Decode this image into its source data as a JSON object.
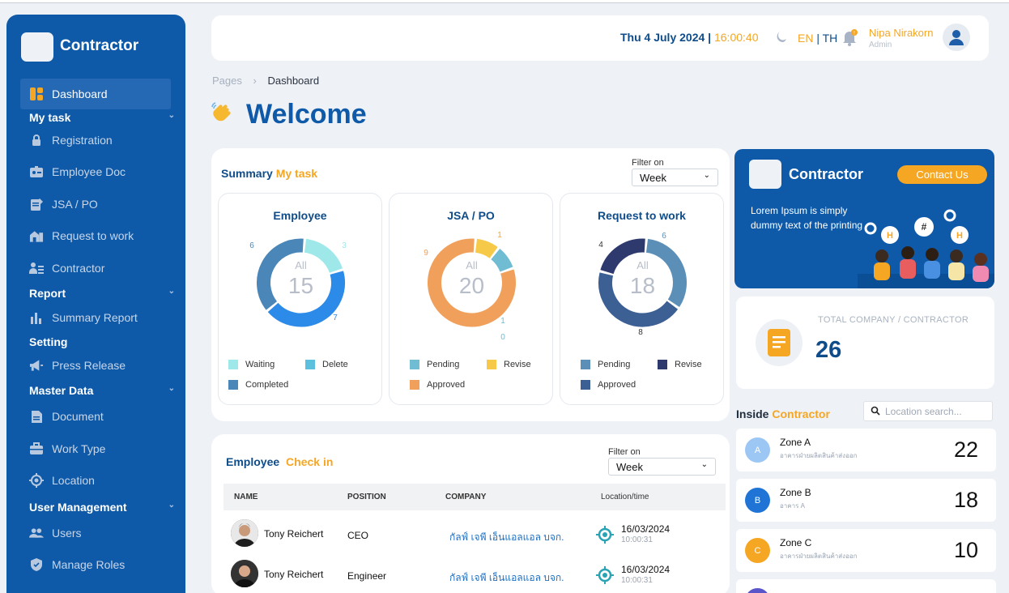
{
  "sidebar": {
    "brand": "Contractor",
    "dashboard": "Dashboard",
    "sections": {
      "my_task": "My task",
      "report": "Report",
      "setting": "Setting",
      "master_data": "Master Data",
      "user_management": "User Management"
    },
    "items": {
      "registration": "Registration",
      "employee_doc": "Employee Doc",
      "jsa_po": "JSA / PO",
      "request_to_work": "Request to work",
      "contractor": "Contractor",
      "summary_report": "Summary Report",
      "press_release": "Press Release",
      "document": "Document",
      "work_type": "Work Type",
      "location": "Location",
      "users": "Users",
      "manage_roles": "Manage Roles"
    }
  },
  "header": {
    "date": "Thu 4 July 2024",
    "separator": "|",
    "time": "16:00:40",
    "lang_en": "EN",
    "lang_sep": "|",
    "lang_th": "TH",
    "user_name": "Nipa Nirakorn",
    "user_role": "Admin"
  },
  "breadcrumb": {
    "root": "Pages",
    "current": "Dashboard"
  },
  "page_title": "Welcome",
  "summary": {
    "title": "Summary",
    "title_highlight": "My task",
    "filter_label": "Filter on",
    "filter_value": "Week",
    "charts": [
      {
        "title": "Employee",
        "center_label": "All",
        "total": "15",
        "segments": [
          {
            "name": "Waiting",
            "value": 3,
            "color": "#9ee8ea"
          },
          {
            "name": "Delete",
            "value": 7,
            "color": "#2c8ae8"
          },
          {
            "name": "Completed",
            "value": 6,
            "color": "#4a87b8"
          }
        ],
        "legend": [
          "Waiting",
          "Delete",
          "Completed"
        ],
        "legend_colors": [
          "#9ee8ea",
          "#5bc0de",
          "#4a87b8"
        ],
        "labels": [
          "3",
          "7",
          "6"
        ]
      },
      {
        "title": "JSA / PO",
        "center_label": "All",
        "total": "20",
        "segments": [
          {
            "name": "Revise",
            "value": 1,
            "color": "#f7c948"
          },
          {
            "name": "Pending",
            "value": 1,
            "color": "#6fbcd3"
          },
          {
            "name": "Approved",
            "value": 9,
            "color": "#f0a05a"
          }
        ],
        "legend": [
          "Pending",
          "Revise",
          "Approved"
        ],
        "legend_colors": [
          "#6fbcd3",
          "#f7c948",
          "#f0a05a"
        ],
        "labels": [
          "1",
          "1",
          "0",
          "9"
        ]
      },
      {
        "title": "Request to work",
        "center_label": "All",
        "total": "18",
        "segments": [
          {
            "name": "Pending",
            "value": 6,
            "color": "#5b8fb8"
          },
          {
            "name": "Approved",
            "value": 8,
            "color": "#3c5f94"
          },
          {
            "name": "Revise",
            "value": 4,
            "color": "#2e3a6e"
          }
        ],
        "legend": [
          "Pending",
          "Revise",
          "Approved"
        ],
        "legend_colors": [
          "#5b8fb8",
          "#2e3a6e",
          "#3c5f94"
        ],
        "labels": [
          "6",
          "8",
          "4"
        ]
      }
    ]
  },
  "promo": {
    "brand": "Contractor",
    "contact_button": "Contact Us",
    "text": "Lorem Ipsum is simply dummy text of the printing"
  },
  "total": {
    "label": "TOTAL COMPANY / CONTRACTOR",
    "value": "26"
  },
  "inside": {
    "title": "Inside",
    "title_highlight": "Contractor",
    "search_placeholder": "Location search...",
    "zones": [
      {
        "badge": "A",
        "name": "Zone A",
        "sub": "อาคารฝ่ายผลิตสินค้าส่งออก",
        "count": "22",
        "color": "#9cc7f5"
      },
      {
        "badge": "B",
        "name": "Zone B",
        "sub": "อาคาร A",
        "count": "18",
        "color": "#1f74d6"
      },
      {
        "badge": "C",
        "name": "Zone C",
        "sub": "อาคารฝ่ายผลิตสินค้าส่งออก",
        "count": "10",
        "color": "#f5a623"
      }
    ]
  },
  "checkin": {
    "title": "Employee",
    "title_highlight": "Check in",
    "filter_label": "Filter on",
    "filter_value": "Week",
    "columns": [
      "NAME",
      "POSITION",
      "COMPANY",
      "Location/time"
    ],
    "rows": [
      {
        "name": "Tony Reichert",
        "position": "CEO",
        "company": "กัลฟ์ เจพี เอ็นแอลแอล บจก.",
        "date": "16/03/2024",
        "time": "10:00:31"
      },
      {
        "name": "Tony Reichert",
        "position": "Engineer",
        "company": "กัลฟ์ เจพี เอ็นแอลแอล บจก.",
        "date": "16/03/2024",
        "time": "10:00:31"
      }
    ]
  }
}
